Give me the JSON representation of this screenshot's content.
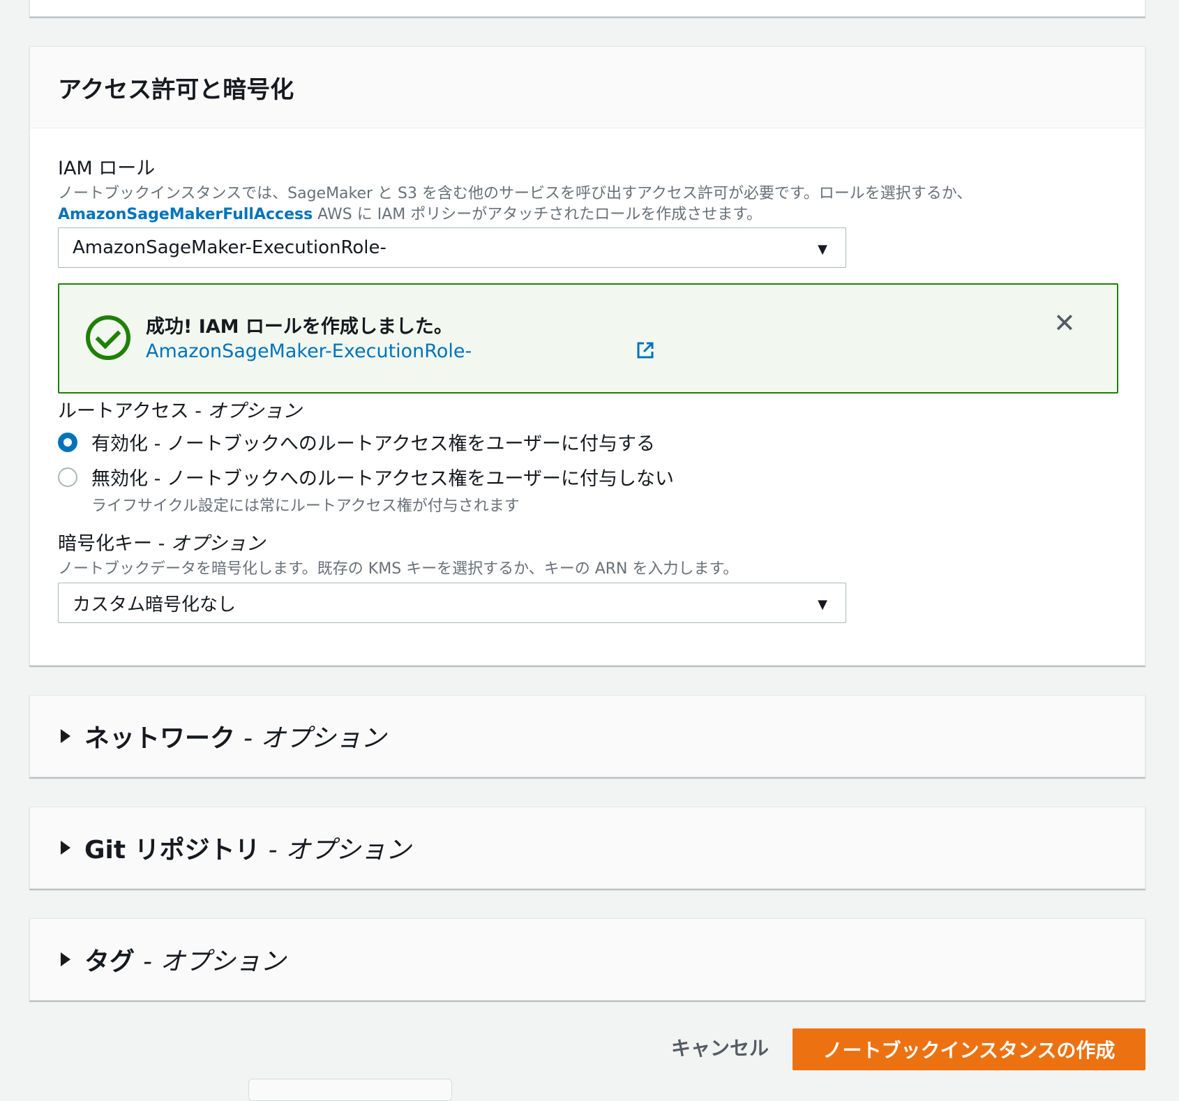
{
  "section": {
    "title": "アクセス許可と暗号化"
  },
  "iam_role": {
    "label": "IAM ロール",
    "desc_line1": "ノートブックインスタンスでは、SageMaker と S3 を含む他のサービスを呼び出すアクセス許可が必要です。ロールを選択するか、",
    "desc_link": "AmazonSageMakerFullAccess",
    "desc_line2_rest": " AWS に IAM ポリシーがアタッチされたロールを作成させます。",
    "selected": "AmazonSageMaker-ExecutionRole-"
  },
  "flash": {
    "title": "成功! IAM ロールを作成しました。",
    "role_link": "AmazonSageMaker-ExecutionRole-",
    "status_color": "#1d8102"
  },
  "root_access": {
    "label": "ルートアクセス - ",
    "label_optional": "オプション",
    "options": [
      {
        "label": "有効化 - ノートブックへのルートアクセス権をユーザーに付与する",
        "checked": true
      },
      {
        "label": "無効化 - ノートブックへのルートアクセス権をユーザーに付与しない",
        "checked": false
      }
    ],
    "note": "ライフサイクル設定には常にルートアクセス権が付与されます"
  },
  "encryption": {
    "label": "暗号化キー - ",
    "label_optional": "オプション",
    "desc": "ノートブックデータを暗号化します。既存の KMS キーを選択するか、キーの ARN を入力します。",
    "selected": "カスタム暗号化なし"
  },
  "collapsibles": [
    {
      "title": "ネットワーク",
      "optional": "- オプション"
    },
    {
      "title": "Git リポジトリ",
      "optional": "- オプション"
    },
    {
      "title": "タグ",
      "optional": "- オプション"
    }
  ],
  "actions": {
    "cancel": "キャンセル",
    "create": "ノートブックインスタンスの作成",
    "primary_color": "#ec7211"
  }
}
